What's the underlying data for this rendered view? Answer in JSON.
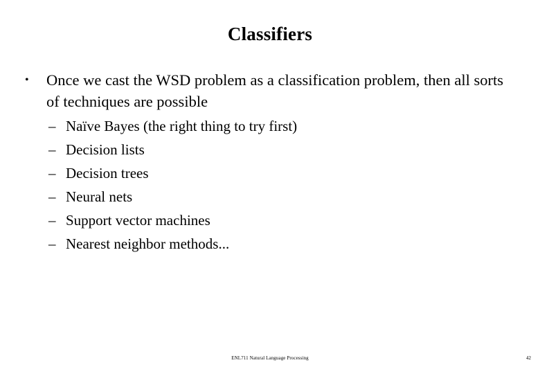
{
  "slide": {
    "title": "Classifiers",
    "background_color": "#ffffff",
    "text_color": "#000000",
    "bullets": [
      {
        "marker": "•",
        "text": "Once we cast the WSD problem as a classification problem, then all sorts of techniques are possible"
      }
    ],
    "sub_bullets": [
      {
        "marker": "–",
        "text": "Naïve Bayes (the right thing to try first)"
      },
      {
        "marker": "–",
        "text": "Decision lists"
      },
      {
        "marker": "–",
        "text": "Decision trees"
      },
      {
        "marker": "–",
        "text": "Neural nets"
      },
      {
        "marker": "–",
        "text": "Support vector machines"
      },
      {
        "marker": "–",
        "text": "Nearest neighbor methods..."
      }
    ],
    "footer": {
      "course": "ENL711 Natural Language Processing",
      "page_number": "42"
    }
  }
}
